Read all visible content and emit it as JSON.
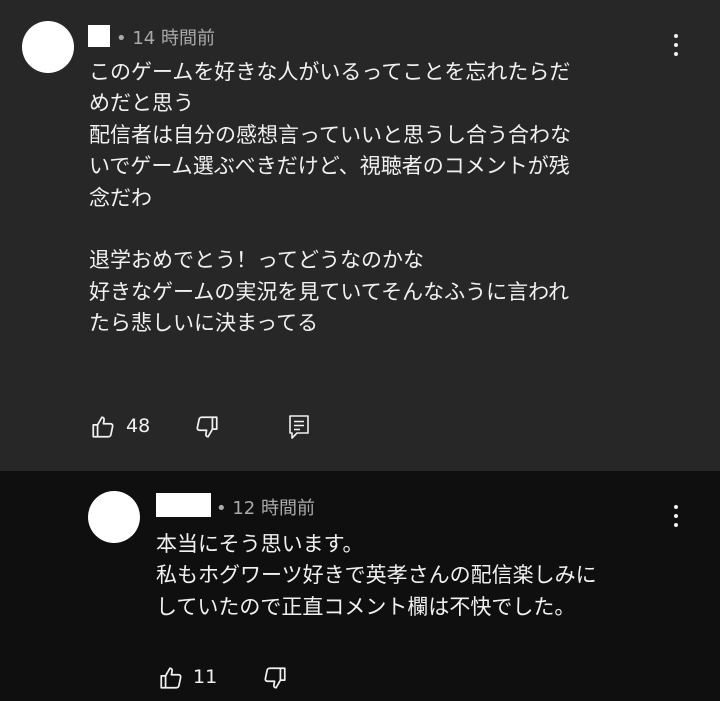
{
  "comments": [
    {
      "time": "• 14 時間前",
      "text": "このゲームを好きな人がいるってことを忘れたらだ\nめだと思う\n配信者は自分の感想言っていいと思うし合う合わな\nいでゲーム選ぶべきだけど、視聴者のコメントが残\n念だわ\n\n退学おめでとう！ってどうなのかな\n好きなゲームの実況を見ていてそんなふうに言われ\nたら悲しいに決まってる",
      "likes": "48"
    },
    {
      "time": "• 12 時間前",
      "text": "本当にそう思います。\n私もホグワーツ好きで英孝さんの配信楽しみに\nしていたので正直コメント欄は不快でした。",
      "likes": "11"
    }
  ],
  "icons": {
    "like": "thumbs-up-icon",
    "dislike": "thumbs-down-icon",
    "reply": "reply-comment-icon",
    "menu": "more-vert-icon"
  },
  "colors": {
    "comment_bg": "#272727",
    "reply_bg": "#0f0f0f",
    "text": "#f1f1f1",
    "meta": "#aaaaaa"
  }
}
